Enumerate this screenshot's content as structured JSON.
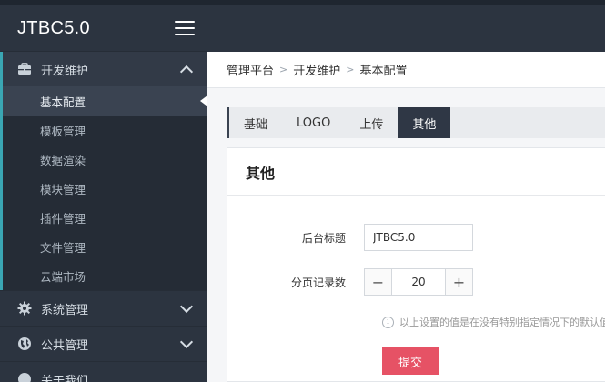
{
  "app": {
    "title": "JTBC5.0"
  },
  "sidebar": {
    "groups": [
      {
        "label": "开发维护",
        "icon": "toolbox-icon",
        "expanded": true,
        "items": [
          {
            "label": "基本配置",
            "active": true
          },
          {
            "label": "模板管理"
          },
          {
            "label": "数据渲染"
          },
          {
            "label": "模块管理"
          },
          {
            "label": "插件管理"
          },
          {
            "label": "文件管理"
          },
          {
            "label": "云端市场"
          }
        ]
      },
      {
        "label": "系统管理",
        "icon": "gear-icon",
        "expanded": false
      },
      {
        "label": "公共管理",
        "icon": "globe-icon",
        "expanded": false
      },
      {
        "label": "关于我们",
        "icon": "info-icon",
        "expanded": false
      }
    ]
  },
  "breadcrumb": [
    "管理平台",
    "开发维护",
    "基本配置"
  ],
  "tabs": [
    {
      "label": "基础"
    },
    {
      "label": "LOGO"
    },
    {
      "label": "上传"
    },
    {
      "label": "其他",
      "active": true
    }
  ],
  "panel": {
    "title": "其他",
    "fields": {
      "admin_title": {
        "label": "后台标题",
        "value": "JTBC5.0"
      },
      "page_size": {
        "label": "分页记录数",
        "value": "20"
      }
    },
    "hint": "以上设置的值是在没有特别指定情况下的默认值",
    "submit_label": "提交"
  },
  "colors": {
    "sidebar_bg": "#2c3440",
    "accent": "#3aa6b3",
    "active_tab": "#2f3745",
    "submit": "#e65265"
  }
}
